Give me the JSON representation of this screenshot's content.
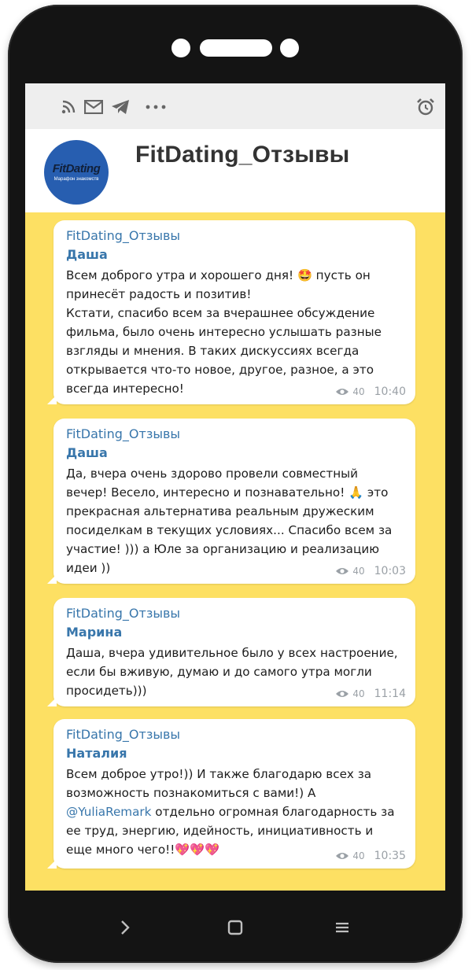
{
  "channel": {
    "title": "FitDating_Отзывы",
    "avatar_logo": "FitDating",
    "avatar_subtitle": "Марафон знакомств"
  },
  "statusbar": {
    "left_icons": [
      "rss-icon",
      "mail-icon",
      "telegram-icon",
      "more-icon"
    ],
    "right_icons": [
      "alarm-clock-icon"
    ]
  },
  "messages": [
    {
      "channel_name": "FitDating_Отзывы",
      "author": "Даша",
      "text_parts": [
        "Всем доброго утра и хорошего дня! ",
        "🤩",
        " пусть он принесёт радость и позитив!\nКстати, спасибо всем за вчерашнее обсуждение фильма, было очень интересно услышать разные взгляды и мнения. В таких дискуссиях всегда открывается что-то новое, другое, разное, а это всегда интересно!"
      ],
      "views": "40",
      "time": "10:40"
    },
    {
      "channel_name": "FitDating_Отзывы",
      "author": "Даша",
      "text_parts": [
        "Да, вчера очень здорово провели совместный вечер! Весело, интересно и познавательно! ",
        "🙏",
        " это прекрасная альтернатива реальным дружеским посиделкам в текущих условиях... Спасибо всем за участие! ))) а Юле за организацию и реализацию идеи ))"
      ],
      "views": "40",
      "time": "10:03"
    },
    {
      "channel_name": "FitDating_Отзывы",
      "author": "Марина",
      "text": "Даша, вчера удивительное было у всех настроение, если бы вживую, думаю и до самого утра могли просидеть)))",
      "views": "40",
      "time": "11:14"
    },
    {
      "channel_name": "FitDating_Отзывы",
      "author": "Наталия",
      "text_before": "Всем доброе утро!)) И также благодарю всех за возможность познакомиться с вами!) А ",
      "mention": "@YuliaRemark",
      "text_after": " отдельно огромная благодарность за ее труд, энергию, идейность, инициативность и еще много чего!!",
      "emojis": "💖💖💖",
      "views": "40",
      "time": "10:35"
    }
  ],
  "colors": {
    "background": "#fde063",
    "accent": "#3876ab",
    "phone_frame": "#141414"
  },
  "navbar_icons": [
    "back-chevron-icon",
    "home-square-icon",
    "menu-icon"
  ]
}
